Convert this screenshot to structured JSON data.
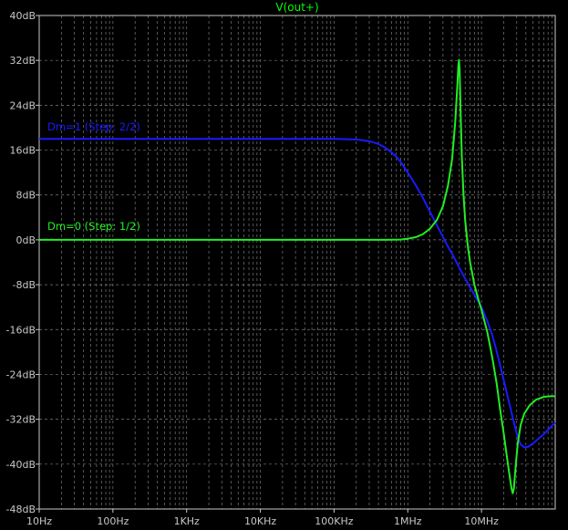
{
  "chart_data": {
    "type": "line",
    "title": "V(out+)",
    "xscale": "log",
    "xlim": [
      10,
      100000000
    ],
    "ylim": [
      -48,
      40
    ],
    "x_ticks": [
      {
        "v": 10,
        "label": "10Hz"
      },
      {
        "v": 100,
        "label": "100Hz"
      },
      {
        "v": 1000,
        "label": "1KHz"
      },
      {
        "v": 10000,
        "label": "10KHz"
      },
      {
        "v": 100000,
        "label": "100KHz"
      },
      {
        "v": 1000000,
        "label": "1MHz"
      },
      {
        "v": 10000000,
        "label": "10MHz"
      }
    ],
    "y_ticks": [
      {
        "v": 40,
        "label": "40dB"
      },
      {
        "v": 32,
        "label": "32dB"
      },
      {
        "v": 24,
        "label": "24dB"
      },
      {
        "v": 16,
        "label": "16dB"
      },
      {
        "v": 8,
        "label": "8dB"
      },
      {
        "v": 0,
        "label": "0dB"
      },
      {
        "v": -8,
        "label": "-8dB"
      },
      {
        "v": -16,
        "label": "-16dB"
      },
      {
        "v": -24,
        "label": "-24dB"
      },
      {
        "v": -32,
        "label": "-32dB"
      },
      {
        "v": -40,
        "label": "-40dB"
      },
      {
        "v": -48,
        "label": "-48dB"
      }
    ],
    "grid": true,
    "legend_placement": "inline-left",
    "series": [
      {
        "name": "Dm=1  (Step: 2/2)",
        "color": "#1a1aff",
        "points": [
          [
            10,
            18.0
          ],
          [
            100,
            18.0
          ],
          [
            1000,
            18.0
          ],
          [
            10000,
            18.0
          ],
          [
            100000,
            18.0
          ],
          [
            200000,
            17.9
          ],
          [
            300000,
            17.6
          ],
          [
            400000,
            17.1
          ],
          [
            500000,
            16.4
          ],
          [
            600000,
            15.6
          ],
          [
            700000,
            14.8
          ],
          [
            800000,
            13.9
          ],
          [
            1000000,
            12.0
          ],
          [
            1300000,
            9.6
          ],
          [
            1600000,
            7.5
          ],
          [
            2000000,
            5.0
          ],
          [
            2500000,
            2.5
          ],
          [
            3000000,
            0.5
          ],
          [
            3500000,
            -1.2
          ],
          [
            4000000,
            -2.5
          ],
          [
            4500000,
            -3.8
          ],
          [
            5000000,
            -5.0
          ],
          [
            6000000,
            -6.9
          ],
          [
            7000000,
            -8.5
          ],
          [
            8000000,
            -9.8
          ],
          [
            9000000,
            -11.0
          ],
          [
            10000000,
            -12.0
          ],
          [
            12000000,
            -14.5
          ],
          [
            14000000,
            -17.0
          ],
          [
            16000000,
            -19.8
          ],
          [
            18000000,
            -22.5
          ],
          [
            20000000,
            -25.0
          ],
          [
            22000000,
            -27.3
          ],
          [
            25000000,
            -30.3
          ],
          [
            28000000,
            -33.0
          ],
          [
            31000000,
            -35.2
          ],
          [
            34000000,
            -36.5
          ],
          [
            38000000,
            -37.0
          ],
          [
            43000000,
            -36.9
          ],
          [
            50000000,
            -36.3
          ],
          [
            60000000,
            -35.4
          ],
          [
            72000000,
            -34.5
          ],
          [
            85000000,
            -33.5
          ],
          [
            100000000,
            -32.6
          ]
        ]
      },
      {
        "name": "Dm=0  (Step: 1/2)",
        "color": "#22ee22",
        "points": [
          [
            10,
            0.0
          ],
          [
            100,
            0.0
          ],
          [
            1000,
            0.0
          ],
          [
            10000,
            0.0
          ],
          [
            100000,
            0.0
          ],
          [
            500000,
            0.0
          ],
          [
            800000,
            0.05
          ],
          [
            1000000,
            0.2
          ],
          [
            1300000,
            0.5
          ],
          [
            1600000,
            1.0
          ],
          [
            2000000,
            2.0
          ],
          [
            2500000,
            3.6
          ],
          [
            3000000,
            6.0
          ],
          [
            3500000,
            9.6
          ],
          [
            4000000,
            14.5
          ],
          [
            4400000,
            21.0
          ],
          [
            4700000,
            27.5
          ],
          [
            4850000,
            31.0
          ],
          [
            4950000,
            32.1
          ],
          [
            5050000,
            30.2
          ],
          [
            5200000,
            23.0
          ],
          [
            5400000,
            15.0
          ],
          [
            5700000,
            8.0
          ],
          [
            6000000,
            3.5
          ],
          [
            6500000,
            -1.0
          ],
          [
            7000000,
            -4.0
          ],
          [
            8000000,
            -8.0
          ],
          [
            9000000,
            -10.5
          ],
          [
            10000000,
            -12.5
          ],
          [
            12000000,
            -16.5
          ],
          [
            14000000,
            -21.0
          ],
          [
            16000000,
            -25.5
          ],
          [
            18000000,
            -30.5
          ],
          [
            20000000,
            -34.5
          ],
          [
            22000000,
            -38.5
          ],
          [
            24000000,
            -42.0
          ],
          [
            25500000,
            -44.3
          ],
          [
            26500000,
            -45.2
          ],
          [
            27500000,
            -44.3
          ],
          [
            29000000,
            -40.5
          ],
          [
            31000000,
            -36.3
          ],
          [
            34000000,
            -33.0
          ],
          [
            38000000,
            -31.0
          ],
          [
            45000000,
            -29.5
          ],
          [
            55000000,
            -28.5
          ],
          [
            70000000,
            -28.0
          ],
          [
            85000000,
            -27.9
          ],
          [
            100000000,
            -27.9
          ]
        ]
      }
    ]
  },
  "legend_colors": {
    "Dm=1  (Step: 2/2)": "#1a1aff",
    "Dm=0  (Step: 1/2)": "#22ee22"
  },
  "axis_color": "#c8c8c8",
  "grid_color": "#7a7a7a"
}
